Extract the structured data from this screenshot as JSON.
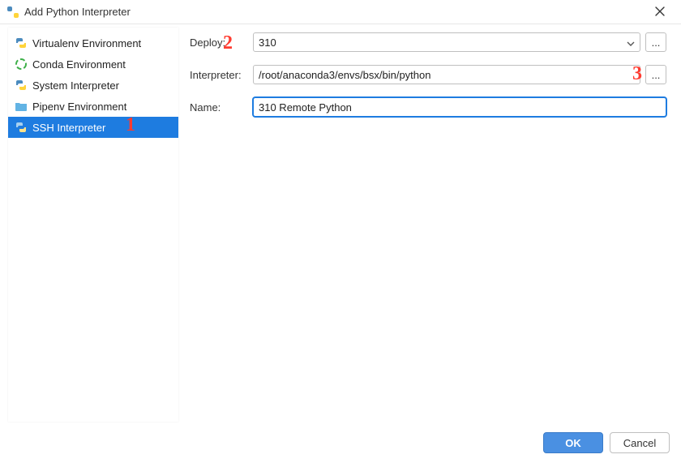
{
  "dialog": {
    "title": "Add Python Interpreter"
  },
  "sidebar": {
    "items": [
      {
        "label": "Virtualenv Environment"
      },
      {
        "label": "Conda Environment"
      },
      {
        "label": "System Interpreter"
      },
      {
        "label": "Pipenv Environment"
      },
      {
        "label": "SSH Interpreter"
      }
    ],
    "selected_index": 4
  },
  "form": {
    "deploy_label": "Deploy:",
    "deploy_value": "310",
    "interpreter_label": "Interpreter:",
    "interpreter_value": "/root/anaconda3/envs/bsx/bin/python",
    "name_label": "Name:",
    "name_value": "310 Remote Python",
    "browse_deploy": "...",
    "browse_interpreter": "..."
  },
  "buttons": {
    "ok": "OK",
    "cancel": "Cancel"
  },
  "annotations": {
    "a1": "1",
    "a2": "2",
    "a3": "3"
  }
}
